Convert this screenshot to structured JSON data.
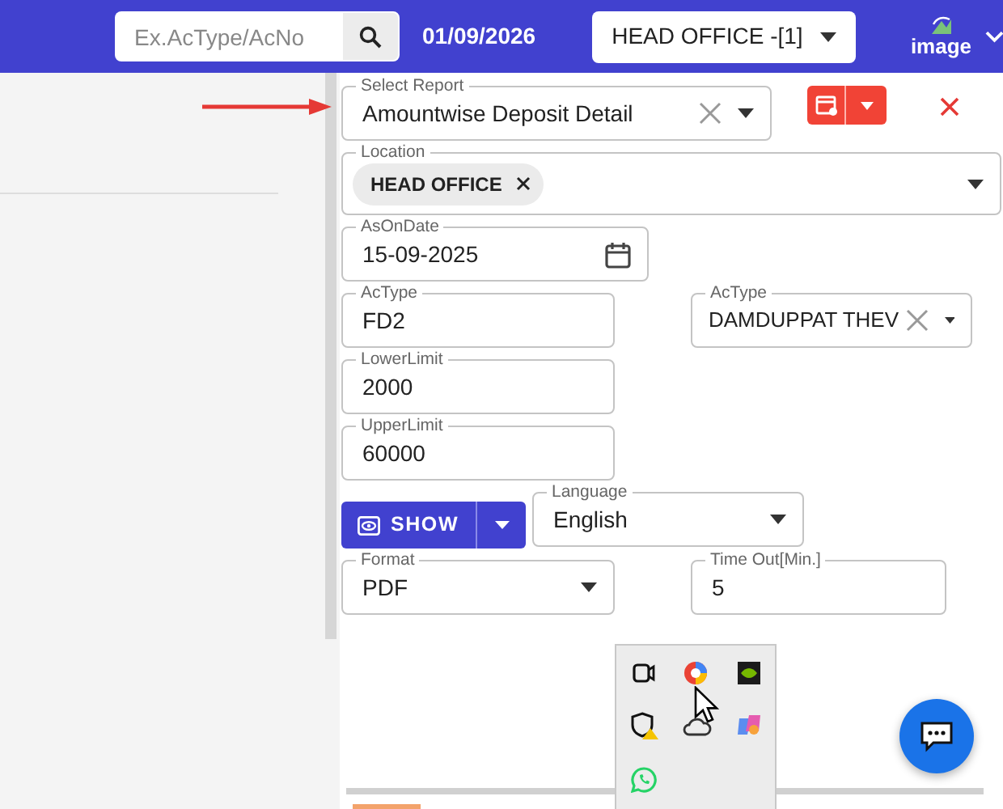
{
  "topbar": {
    "search": {
      "placeholder": "Ex.AcType/AcNo"
    },
    "date": "01/09/2026",
    "branch_select": {
      "value": "HEAD OFFICE -[1]"
    },
    "profile": {
      "alt_text": "image"
    }
  },
  "report": {
    "label": "Select Report",
    "value": "Amountwise Deposit Detail"
  },
  "location": {
    "label": "Location",
    "chips": [
      "HEAD OFFICE"
    ]
  },
  "rows": [
    [
      {
        "kind": "date",
        "label": "AsOnDate",
        "value": "15-09-2025"
      }
    ],
    [
      {
        "kind": "text",
        "label": "AcType",
        "value": "FD2"
      },
      {
        "kind": "clearable_select",
        "label": "AcType",
        "value": "DAMDUPPAT THEV"
      }
    ],
    [
      {
        "kind": "text",
        "label": "LowerLimit",
        "value": "2000"
      }
    ],
    [
      {
        "kind": "text",
        "label": "UpperLimit",
        "value": "60000"
      }
    ],
    [
      {
        "kind": "split_button",
        "label": "SHOW"
      },
      {
        "kind": "select",
        "label": "Language",
        "value": "English"
      }
    ],
    [
      {
        "kind": "select",
        "label": "Format",
        "value": "PDF"
      },
      {
        "kind": "text",
        "label": "Time Out[Min.]",
        "value": "5"
      }
    ]
  ]
}
